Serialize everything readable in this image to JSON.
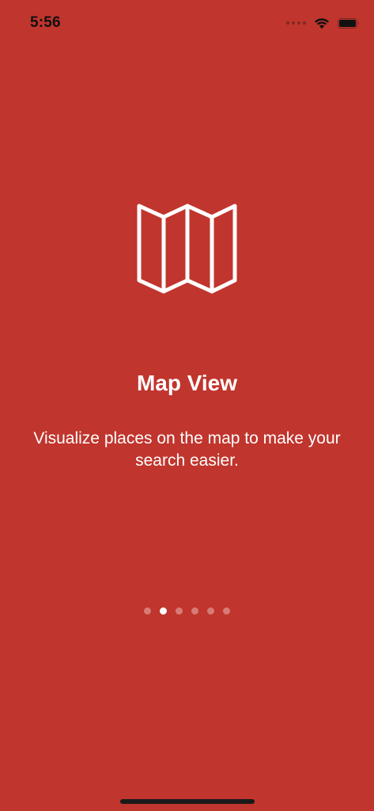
{
  "status_bar": {
    "time": "5:56"
  },
  "onboarding": {
    "title": "Map View",
    "description": "Visualize places on the map to make your search easier.",
    "icon": "map-icon",
    "page_count": 6,
    "current_page": 2
  },
  "colors": {
    "background": "#C0352D",
    "text": "#FFFFFF"
  }
}
